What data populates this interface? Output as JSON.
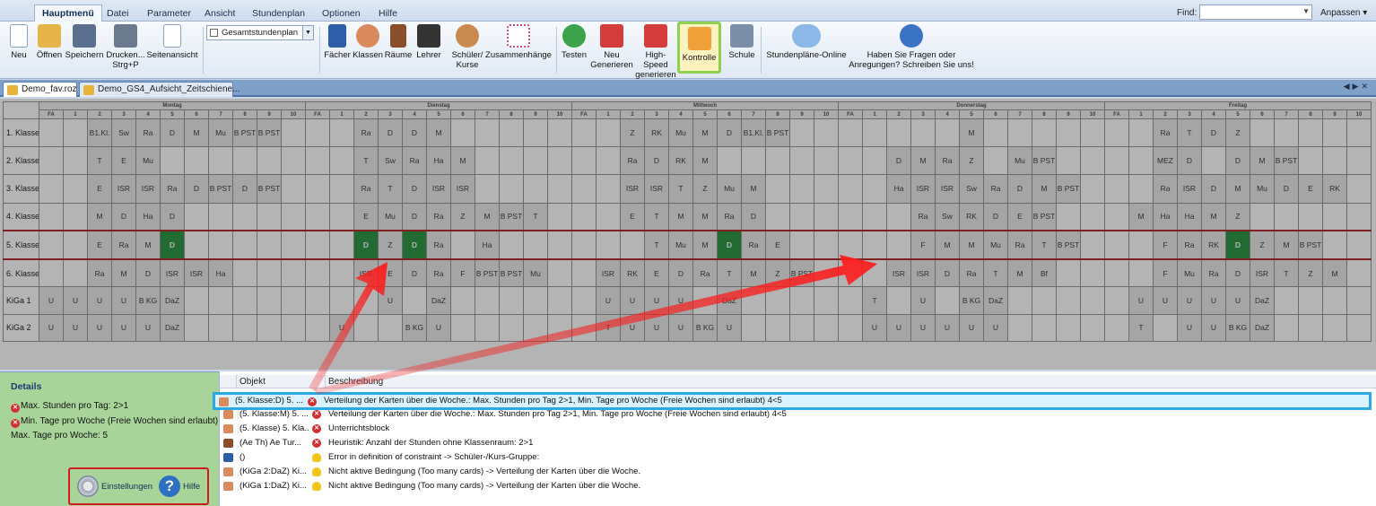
{
  "ribbon_tabs": [
    "Hauptmenü",
    "Datei",
    "Parameter",
    "Ansicht",
    "Stundenplan",
    "Optionen",
    "Hilfe"
  ],
  "search": {
    "label": "Find:",
    "value": ""
  },
  "customize": "Anpassen ▾",
  "plan_select": "Gesamtstundenplan",
  "toolbar": [
    {
      "label": "Neu",
      "icon": "new-file-icon"
    },
    {
      "label": "Öffnen",
      "icon": "folder-icon"
    },
    {
      "label": "Speichern",
      "icon": "save-icon"
    },
    {
      "label": "Drucken...\nStrg+P",
      "icon": "print-icon"
    },
    {
      "label": "Seitenansicht",
      "icon": "page-preview-icon"
    },
    {
      "label": "Fächer",
      "icon": "book-icon"
    },
    {
      "label": "Klassen",
      "icon": "class-icon"
    },
    {
      "label": "Räume",
      "icon": "door-icon"
    },
    {
      "label": "Lehrer",
      "icon": "teacher-hat-icon"
    },
    {
      "label": "Schüler/\nKurse",
      "icon": "students-icon"
    },
    {
      "label": "Zusammenhänge",
      "icon": "network-icon"
    },
    {
      "label": "Testen",
      "icon": "check-icon"
    },
    {
      "label": "Neu\nGenerieren",
      "icon": "generate-icon"
    },
    {
      "label": "High-Speed\ngenerieren",
      "icon": "highspeed-icon"
    },
    {
      "label": "Kontrolle",
      "icon": "gavel-icon"
    },
    {
      "label": "Schule",
      "icon": "school-icon"
    },
    {
      "label": "Stundenpläne-Online",
      "icon": "cloud-icon"
    },
    {
      "label": "Haben Sie Fragen oder\nAnregungen? Schreiben Sie uns!",
      "icon": "question-icon"
    }
  ],
  "doc_tabs": [
    "Demo_fav.roz",
    "Demo_GS4_Aufsicht_Zeitschiene..."
  ],
  "days": [
    "Montag",
    "Dienstag",
    "Mittwoch",
    "Donnerstag",
    "Freitag"
  ],
  "periods": [
    "FA",
    "1",
    "2",
    "3",
    "4",
    "5",
    "6",
    "7",
    "8",
    "9",
    "10"
  ],
  "classes": [
    {
      "name": "1. Klasse",
      "cells": [
        [
          "",
          "",
          "B1.Kl.",
          "Sw",
          "Ra",
          "D",
          "M",
          "Mu",
          "B PST",
          "B PST",
          ""
        ],
        [
          "",
          "",
          "Ra",
          "D",
          "D",
          "M",
          "",
          "",
          "",
          "",
          ""
        ],
        [
          "",
          "",
          "Z",
          "RK",
          "Mu",
          "M",
          "D",
          "B1.Kl.",
          "B PST",
          "",
          ""
        ],
        [
          "",
          "",
          "",
          "",
          "",
          "M",
          "",
          "",
          "",
          "",
          ""
        ],
        [
          "",
          "",
          "Ra",
          "T",
          "D",
          "Z",
          "",
          "",
          "",
          "",
          ""
        ]
      ]
    },
    {
      "name": "2. Klasse",
      "cells": [
        [
          "",
          "",
          "T",
          "E",
          "Mu",
          "",
          "",
          "",
          "",
          "",
          ""
        ],
        [
          "",
          "",
          "T",
          "Sw",
          "Ra",
          "Ha",
          "M",
          "",
          "",
          "",
          ""
        ],
        [
          "",
          "",
          "Ra",
          "D",
          "RK",
          "M",
          "",
          "",
          "",
          "",
          ""
        ],
        [
          "",
          "",
          "D",
          "M",
          "Ra",
          "Z",
          "",
          "Mu",
          "B PST",
          "",
          ""
        ],
        [
          "",
          "",
          "MEZ",
          "D",
          "",
          "D",
          "M",
          "B PST",
          "",
          "",
          ""
        ]
      ]
    },
    {
      "name": "3. Klasse",
      "cells": [
        [
          "",
          "",
          "E",
          "ISR",
          "ISR",
          "Ra",
          "D",
          "B PST",
          "D",
          "B PST",
          ""
        ],
        [
          "",
          "",
          "Ra",
          "T",
          "D",
          "ISR",
          "ISR",
          "",
          "",
          "",
          ""
        ],
        [
          "",
          "",
          "ISR",
          "ISR",
          "T",
          "Z",
          "Mu",
          "M",
          "",
          "",
          ""
        ],
        [
          "",
          "",
          "Ha",
          "ISR",
          "ISR",
          "Sw",
          "Ra",
          "D",
          "M",
          "B PST",
          ""
        ],
        [
          "",
          "",
          "Ra",
          "ISR",
          "D",
          "M",
          "Mu",
          "D",
          "E",
          "RK",
          ""
        ]
      ]
    },
    {
      "name": "4. Klasse",
      "cells": [
        [
          "",
          "",
          "M",
          "D",
          "Ha",
          "D",
          "",
          "",
          "",
          "",
          ""
        ],
        [
          "",
          "",
          "E",
          "Mu",
          "D",
          "Ra",
          "Z",
          "M",
          "B PST",
          "T",
          ""
        ],
        [
          "",
          "",
          "E",
          "T",
          "M",
          "M",
          "Ra",
          "D",
          "",
          "",
          ""
        ],
        [
          "",
          "",
          "",
          "Ra",
          "Sw",
          "RK",
          "D",
          "E",
          "B PST",
          "",
          ""
        ],
        [
          "",
          "M",
          "Ha",
          "Ha",
          "M",
          "Z",
          "",
          "",
          "",
          "",
          ""
        ]
      ]
    },
    {
      "name": "5. Klasse",
      "cells": [
        [
          "",
          "",
          "E",
          "Ra",
          "M",
          "D",
          "",
          "",
          "",
          "",
          ""
        ],
        [
          "",
          "",
          "D",
          "Z",
          "D",
          "Ra",
          "",
          "Ha",
          "",
          "",
          ""
        ],
        [
          "",
          "",
          "",
          "T",
          "Mu",
          "M",
          "D",
          "Ra",
          "E",
          "",
          ""
        ],
        [
          "",
          "",
          "",
          "F",
          "M",
          "M",
          "Mu",
          "Ra",
          "T",
          "B PST",
          ""
        ],
        [
          "",
          "",
          "F",
          "Ra",
          "RK",
          "D",
          "Z",
          "M",
          "B PST",
          "",
          ""
        ]
      ]
    },
    {
      "name": "6. Klasse",
      "cells": [
        [
          "",
          "",
          "Ra",
          "M",
          "D",
          "ISR",
          "ISR",
          "Ha",
          "",
          "",
          ""
        ],
        [
          "",
          "",
          "ISR",
          "E",
          "D",
          "Ra",
          "F",
          "B PST",
          "B PST",
          "Mu",
          ""
        ],
        [
          "",
          "ISR",
          "RK",
          "E",
          "D",
          "Ra",
          "T",
          "M",
          "Z",
          "B PST",
          ""
        ],
        [
          "",
          "",
          "ISR",
          "ISR",
          "D",
          "Ra",
          "T",
          "M",
          "Bf",
          "",
          ""
        ],
        [
          "",
          "",
          "F",
          "Mu",
          "Ra",
          "D",
          "ISR",
          "T",
          "Z",
          "M",
          ""
        ]
      ]
    },
    {
      "name": "KiGa 1",
      "cells": [
        [
          "U",
          "U",
          "U",
          "U",
          "B KG",
          "DaZ",
          "",
          "",
          "",
          "",
          ""
        ],
        [
          "",
          "",
          "",
          "U",
          "",
          "DaZ",
          "",
          "",
          "",
          "",
          ""
        ],
        [
          "",
          "U",
          "U",
          "U",
          "U",
          "",
          "DaZ",
          "",
          "",
          "",
          ""
        ],
        [
          "",
          "T",
          "",
          "U",
          "",
          "B KG",
          "DaZ",
          "",
          "",
          "",
          ""
        ],
        [
          "",
          "U",
          "U",
          "U",
          "U",
          "U",
          "DaZ",
          "",
          "",
          "",
          ""
        ]
      ]
    },
    {
      "name": "KiGa 2",
      "cells": [
        [
          "U",
          "U",
          "U",
          "U",
          "U",
          "DaZ",
          "",
          "",
          "",
          "",
          ""
        ],
        [
          "",
          "U",
          "",
          "",
          "B KG",
          "U",
          "",
          "",
          "",
          "",
          ""
        ],
        [
          "",
          "T",
          "U",
          "U",
          "U",
          "B KG",
          "U",
          "",
          "",
          "",
          ""
        ],
        [
          "",
          "U",
          "U",
          "U",
          "U",
          "U",
          "U",
          "",
          "",
          "",
          ""
        ],
        [
          "",
          "T",
          "",
          "U",
          "U",
          "B KG",
          "DaZ",
          "",
          "",
          "",
          ""
        ]
      ]
    }
  ],
  "highlight": {
    "green_cells": "D",
    "selected_row": "5. Klasse"
  },
  "details": {
    "title": "Details",
    "lines": [
      "Max. Stunden pro Tag: 2>1",
      "Min. Tage pro Woche (Freie Wochen sind erlaubt): 4<5",
      "Max. Tage pro Woche: 5"
    ],
    "settings_label": "Einstellungen",
    "help_label": "Hilfe"
  },
  "errors": {
    "columns": [
      "Objekt",
      "Beschreibung"
    ],
    "rows": [
      {
        "obj": "(5. Klasse:D) 5. ...",
        "desc": "Verteilung der Karten über die Woche.: Max. Stunden pro Tag 2>1, Min. Tage pro Woche (Freie Wochen sind erlaubt) 4<5",
        "type": "err",
        "icon": "person-icon"
      },
      {
        "obj": "(5. Klasse:M) 5. ...",
        "desc": "Verteilung der Karten über die Woche.: Max. Stunden pro Tag 2>1, Min. Tage pro Woche (Freie Wochen sind erlaubt) 4<5",
        "type": "err",
        "icon": "person-icon"
      },
      {
        "obj": "(5. Klasse) 5. Kla...",
        "desc": "Unterrichtsblock",
        "type": "err",
        "icon": "person-icon"
      },
      {
        "obj": "(Ae Th) Ae Tur...",
        "desc": "Heuristik: Anzahl der Stunden ohne Klassenraum: 2>1",
        "type": "err",
        "icon": "door-icon"
      },
      {
        "obj": "()",
        "desc": "Error in definition of constraint -> Schüler-/Kurs-Gruppe:",
        "type": "info",
        "icon": "book-icon"
      },
      {
        "obj": "(KiGa 2:DaZ) Ki...",
        "desc": "Nicht aktive Bedingung (Too many cards) -> Verteilung der Karten über die Woche.",
        "type": "info",
        "icon": "person-icon"
      },
      {
        "obj": "(KiGa 1:DaZ) Ki...",
        "desc": "Nicht aktive Bedingung (Too many cards) -> Verteilung der Karten über die Woche.",
        "type": "info",
        "icon": "person-icon"
      }
    ]
  },
  "colors": {
    "accent": "#1f8f3a",
    "selection": "#2ea8e3",
    "warning_red": "#d11d1d"
  }
}
